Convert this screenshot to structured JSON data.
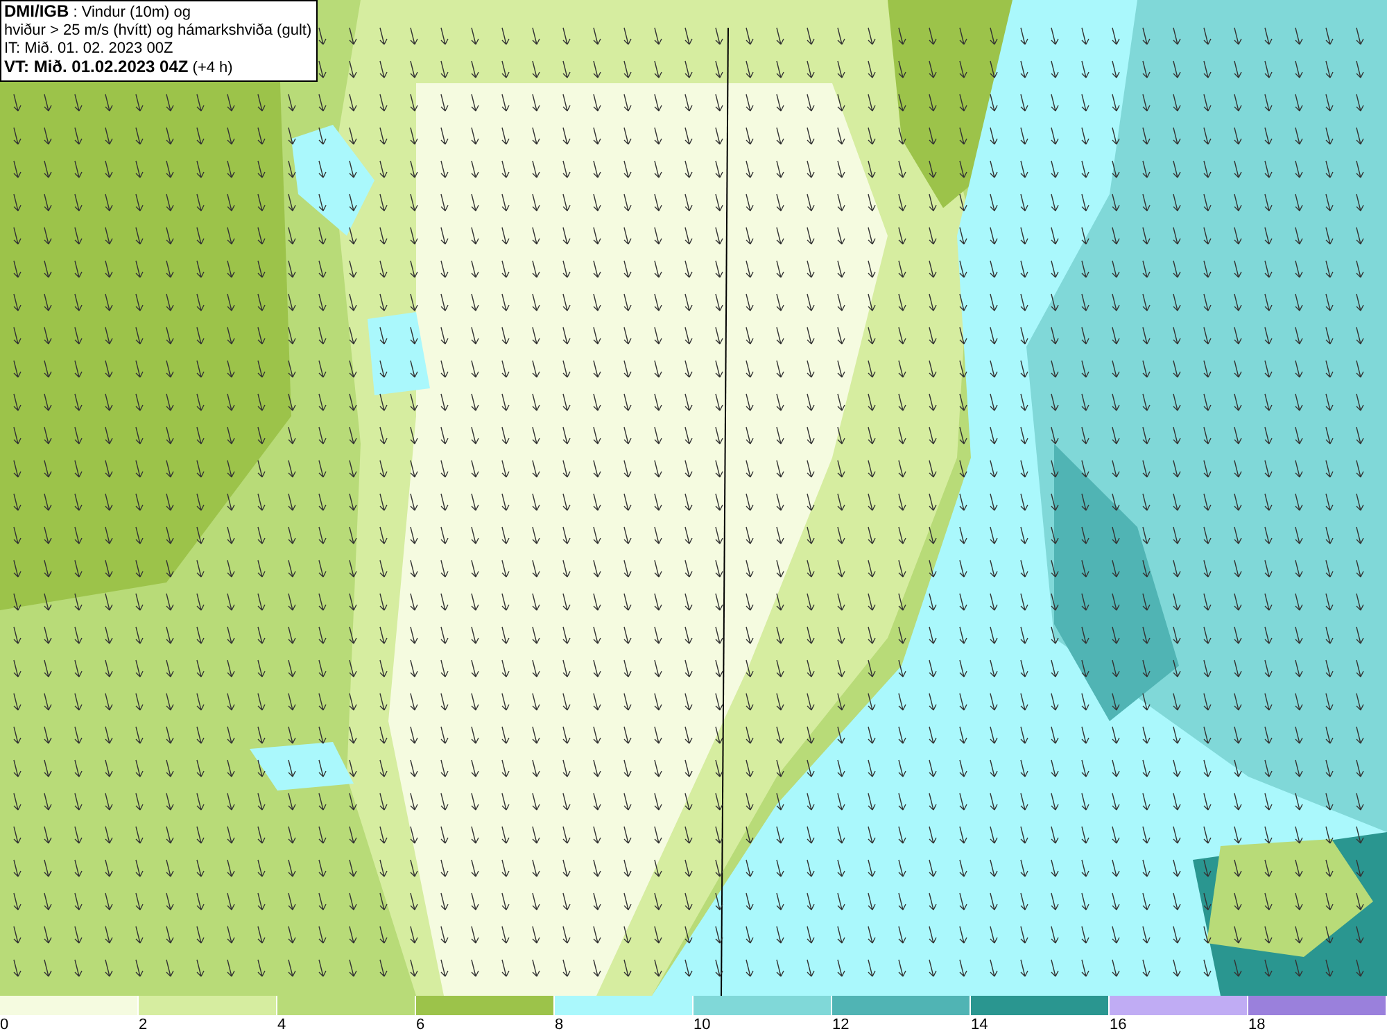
{
  "header": {
    "lines": [
      "**DMI/IGB** : Vindur (10m) og",
      "hviður > 25 m/s (hvítt) og hámarkshviða (gult)",
      "IT: Mið. 01. 02. 2023 00Z",
      "**VT: Mið. 01.02.2023 04Z** (+4 h)"
    ]
  },
  "legend": {
    "bands": [
      {
        "color": "#f5fbe0"
      },
      {
        "color": "#d6eda0"
      },
      {
        "color": "#b8db78"
      },
      {
        "color": "#9cc34a"
      },
      {
        "color": "#aaf8fc"
      },
      {
        "color": "#80d8d8"
      },
      {
        "color": "#50b4b4"
      },
      {
        "color": "#2a9690"
      },
      {
        "color": "#c0acf4"
      },
      {
        "color": "#9a80dc"
      }
    ],
    "ticks": [
      "0",
      "2",
      "4",
      "6",
      "8",
      "10",
      "12",
      "14",
      "16",
      "18"
    ]
  }
}
